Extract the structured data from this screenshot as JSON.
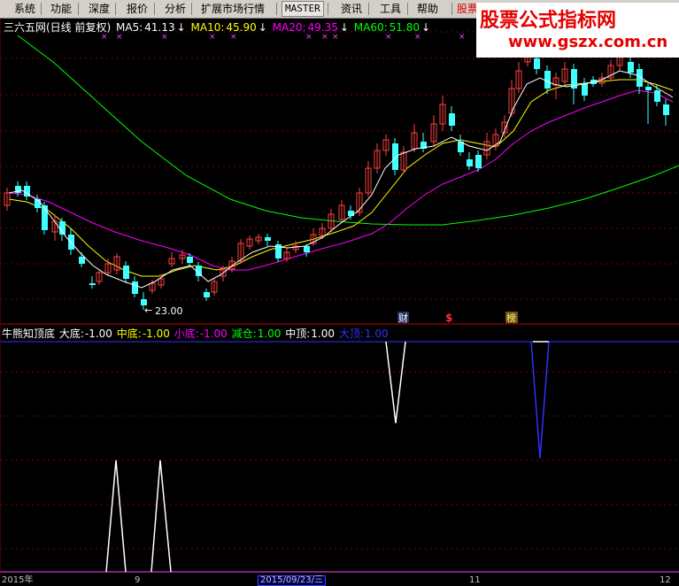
{
  "menu": {
    "items": [
      {
        "label": "系统"
      },
      {
        "label": "功能"
      },
      {
        "label": "深度"
      },
      {
        "label": "报价"
      },
      {
        "label": "分析"
      },
      {
        "label": "扩展市场行情"
      },
      {
        "label": "MASTER"
      },
      {
        "label": "资讯"
      },
      {
        "label": "工具"
      },
      {
        "label": "帮助"
      },
      {
        "label": "股票"
      }
    ]
  },
  "watermark": {
    "title": "股票公式指标网",
    "url": "www.gszx.com.cn"
  },
  "main_chart": {
    "title": "三六五网(日线 前复权)",
    "ma": [
      {
        "label": "MA5:",
        "value": "41.13",
        "arrow": "↓",
        "color": "#ffffff"
      },
      {
        "label": "MA10:",
        "value": "45.90",
        "arrow": "↓",
        "color": "#ffff00"
      },
      {
        "label": "MA20:",
        "value": "49.35",
        "arrow": "↓",
        "color": "#ff00ff"
      },
      {
        "label": "MA60:",
        "value": "51.80",
        "arrow": "↓",
        "color": "#00ff00"
      }
    ],
    "low_label": "23.00",
    "markers": {
      "cai": "财",
      "dollar": "$",
      "bang": "榜"
    }
  },
  "indicator": {
    "title": "牛熊知顶底",
    "values": [
      {
        "label": "大底:",
        "value": "-1.00",
        "color": "#ffffff"
      },
      {
        "label": "中底:",
        "value": "-1.00",
        "color": "#ffff00"
      },
      {
        "label": "小底:",
        "value": "-1.00",
        "color": "#ff00ff"
      },
      {
        "label": "减仓:",
        "value": "1.00",
        "color": "#00ff00"
      },
      {
        "label": "中顶:",
        "value": "1.00",
        "color": "#ffffff"
      },
      {
        "label": "大顶:",
        "value": "1.00",
        "color": "#3030ff"
      }
    ]
  },
  "bottom_axis": {
    "year": "2015年",
    "tick1": "9",
    "date": "2015/09/23/三",
    "tick2": "11",
    "tick3": "12"
  },
  "colors": {
    "up": "#ff4040",
    "down": "#40ffff",
    "ma5": "#ffffff",
    "ma10": "#ffff00",
    "ma20": "#ff00ff",
    "ma60": "#00ff00",
    "grid": "#800000"
  }
}
